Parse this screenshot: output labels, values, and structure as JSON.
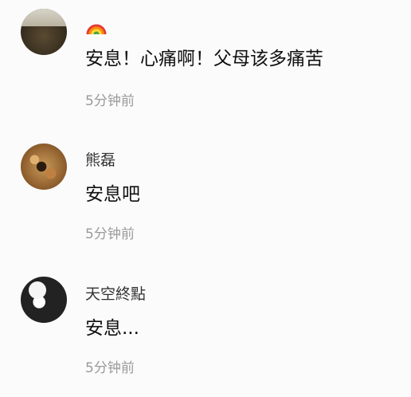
{
  "comments": [
    {
      "username": "",
      "username_icon": "rainbow-icon",
      "content": "安息！心痛啊！父母该多痛苦",
      "time": "5分钟前"
    },
    {
      "username": "熊磊",
      "content": "安息吧",
      "time": "5分钟前"
    },
    {
      "username": "天空終點",
      "content": "安息...",
      "time": "5分钟前"
    }
  ]
}
